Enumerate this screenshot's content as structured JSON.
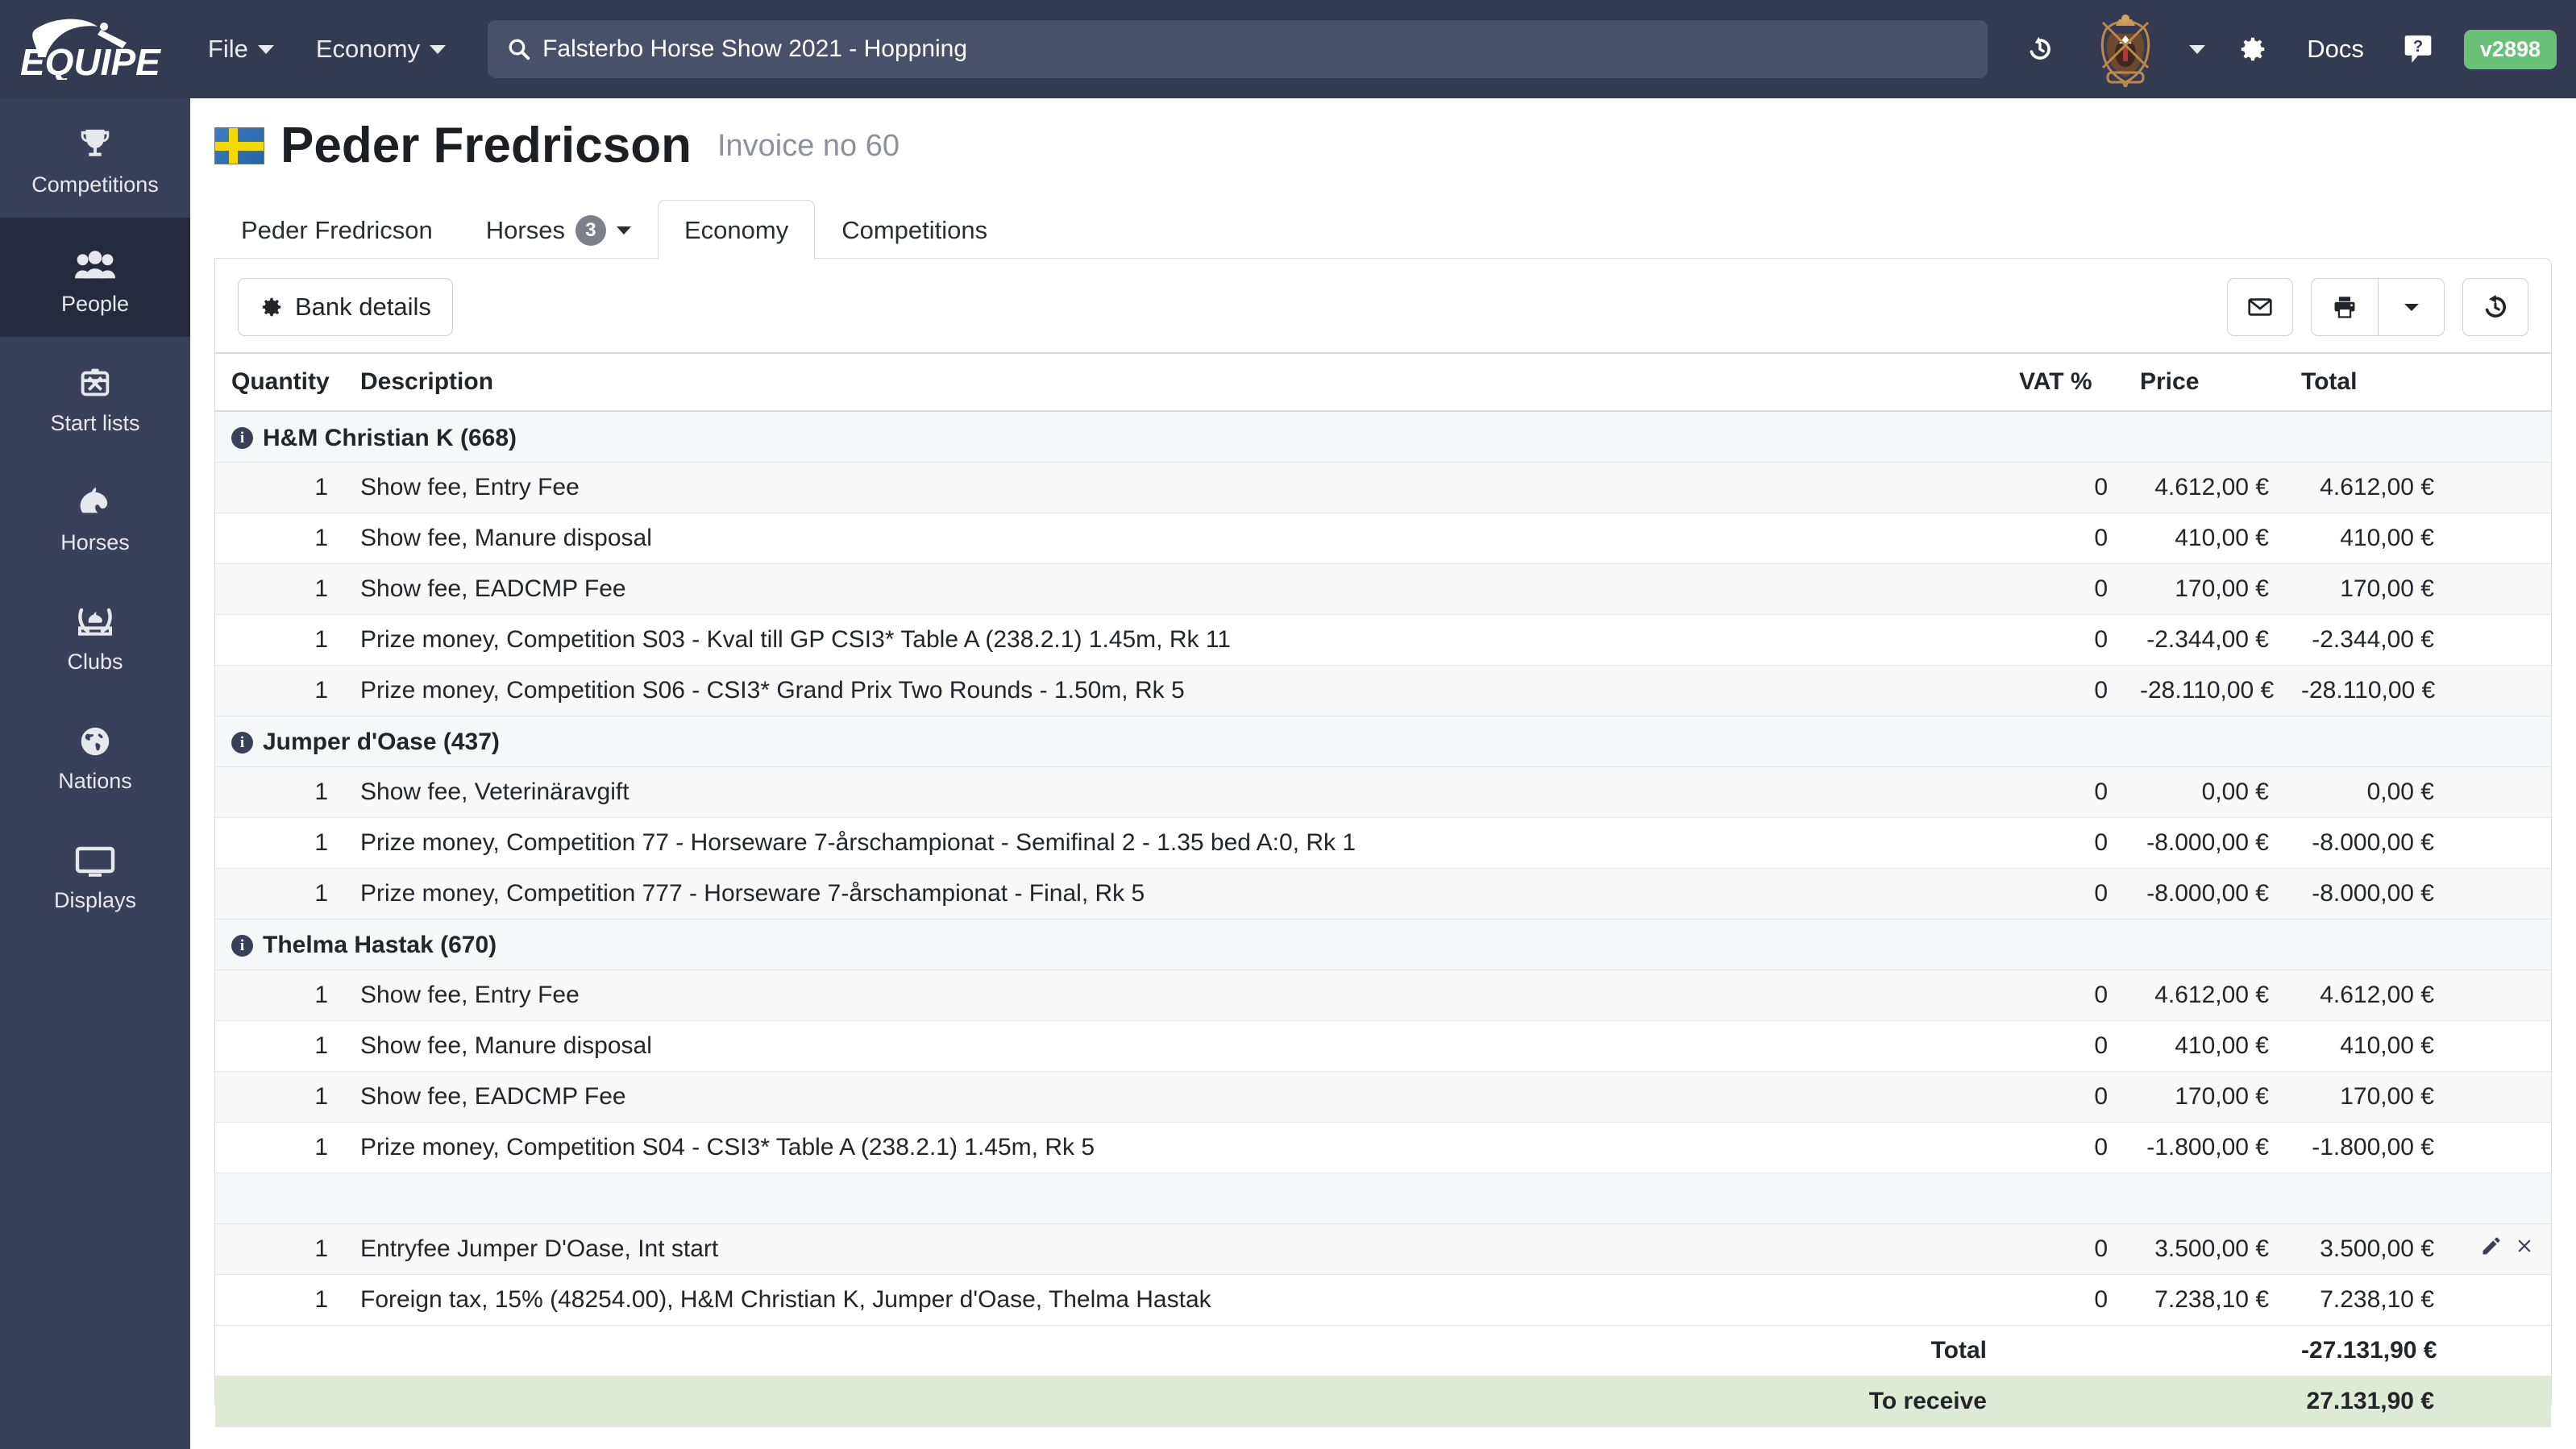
{
  "topbar": {
    "brand": "EQUIPE",
    "menus": [
      {
        "label": "File",
        "icon": "chevron-down-icon"
      },
      {
        "label": "Economy",
        "icon": "chevron-down-icon"
      }
    ],
    "search": {
      "value": "Falsterbo Horse Show 2021 - Hoppning",
      "icon": "search-icon"
    },
    "history_icon": "history-icon",
    "show_crest_alt": "Falsterbo Horse Show",
    "settings_icon": "gear-icon",
    "docs_label": "Docs",
    "help_icon": "question-mark-icon",
    "version": "v2898"
  },
  "sidebar": {
    "items": [
      {
        "label": "Competitions",
        "icon": "trophy-icon",
        "active": false
      },
      {
        "label": "People",
        "icon": "people-icon",
        "active": true
      },
      {
        "label": "Start lists",
        "icon": "clipboard-icon",
        "active": false
      },
      {
        "label": "Horses",
        "icon": "horse-head-icon",
        "active": false
      },
      {
        "label": "Clubs",
        "icon": "club-emblem-icon",
        "active": false
      },
      {
        "label": "Nations",
        "icon": "globe-icon",
        "active": false
      },
      {
        "label": "Displays",
        "icon": "monitor-icon",
        "active": false
      }
    ]
  },
  "page": {
    "flag": "sweden-flag",
    "title": "Peder Fredricson",
    "subtitle": "Invoice no 60"
  },
  "tabs": [
    {
      "label": "Peder Fredricson",
      "active": false,
      "badge": null,
      "caret": false
    },
    {
      "label": "Horses",
      "active": false,
      "badge": "3",
      "caret": true
    },
    {
      "label": "Economy",
      "active": true,
      "badge": null,
      "caret": false
    },
    {
      "label": "Competitions",
      "active": false,
      "badge": null,
      "caret": false
    }
  ],
  "toolbar": {
    "bank_details_label": "Bank details",
    "bank_details_icon": "gear-icon",
    "email_icon": "envelope-icon",
    "print_icon": "printer-icon",
    "print_caret_icon": "chevron-down-icon",
    "history_icon": "history-icon"
  },
  "table": {
    "columns": {
      "quantity": "Quantity",
      "description": "Description",
      "vat": "VAT %",
      "price": "Price",
      "total": "Total",
      "actions": ""
    },
    "groups": [
      {
        "name": "H&M Christian K (668)",
        "rows": [
          {
            "qty": "1",
            "desc": "Show fee, Entry Fee",
            "vat": "0",
            "price": "4.612,00 €",
            "total": "4.612,00 €"
          },
          {
            "qty": "1",
            "desc": "Show fee, Manure disposal",
            "vat": "0",
            "price": "410,00 €",
            "total": "410,00 €"
          },
          {
            "qty": "1",
            "desc": "Show fee, EADCMP Fee",
            "vat": "0",
            "price": "170,00 €",
            "total": "170,00 €"
          },
          {
            "qty": "1",
            "desc": "Prize money, Competition S03 - Kval till GP CSI3* Table A (238.2.1) 1.45m, Rk 11",
            "vat": "0",
            "price": "-2.344,00 €",
            "total": "-2.344,00 €"
          },
          {
            "qty": "1",
            "desc": "Prize money, Competition S06 - CSI3* Grand Prix Two Rounds - 1.50m, Rk 5",
            "vat": "0",
            "price": "-28.110,00 €",
            "total": "-28.110,00 €"
          }
        ]
      },
      {
        "name": "Jumper d'Oase (437)",
        "rows": [
          {
            "qty": "1",
            "desc": "Show fee, Veterinäravgift",
            "vat": "0",
            "price": "0,00 €",
            "total": "0,00 €"
          },
          {
            "qty": "1",
            "desc": "Prize money, Competition 77 - Horseware 7-årschampionat - Semifinal 2 - 1.35 bed A:0, Rk 1",
            "vat": "0",
            "price": "-8.000,00 €",
            "total": "-8.000,00 €"
          },
          {
            "qty": "1",
            "desc": "Prize money, Competition 777 - Horseware 7-årschampionat - Final, Rk 5",
            "vat": "0",
            "price": "-8.000,00 €",
            "total": "-8.000,00 €"
          }
        ]
      },
      {
        "name": "Thelma Hastak (670)",
        "rows": [
          {
            "qty": "1",
            "desc": "Show fee, Entry Fee",
            "vat": "0",
            "price": "4.612,00 €",
            "total": "4.612,00 €"
          },
          {
            "qty": "1",
            "desc": "Show fee, Manure disposal",
            "vat": "0",
            "price": "410,00 €",
            "total": "410,00 €"
          },
          {
            "qty": "1",
            "desc": "Show fee, EADCMP Fee",
            "vat": "0",
            "price": "170,00 €",
            "total": "170,00 €"
          },
          {
            "qty": "1",
            "desc": "Prize money, Competition S04 - CSI3* Table A (238.2.1) 1.45m, Rk 5",
            "vat": "0",
            "price": "-1.800,00 €",
            "total": "-1.800,00 €"
          }
        ]
      }
    ],
    "extra_rows": [
      {
        "qty": "1",
        "desc": "Entryfee Jumper D'Oase, Int start",
        "vat": "0",
        "price": "3.500,00 €",
        "total": "3.500,00 €",
        "actions": [
          "edit-icon",
          "delete-icon"
        ]
      },
      {
        "qty": "1",
        "desc": "Foreign tax, 15% (48254.00), H&M Christian K, Jumper d'Oase, Thelma Hastak",
        "vat": "0",
        "price": "7.238,10 €",
        "total": "7.238,10 €",
        "actions": []
      }
    ],
    "summary": [
      {
        "label": "Total",
        "total": "-27.131,90 €",
        "kind": "total"
      },
      {
        "label": "To receive",
        "total": "27.131,90 €",
        "kind": "receive"
      }
    ]
  },
  "colors": {
    "topbar": "#343a51",
    "sidebar": "#3a405a",
    "sidebar_active": "#262a3e",
    "version_badge": "#69c178",
    "receive_row": "#dfead4",
    "group_text": "#3a405a"
  }
}
